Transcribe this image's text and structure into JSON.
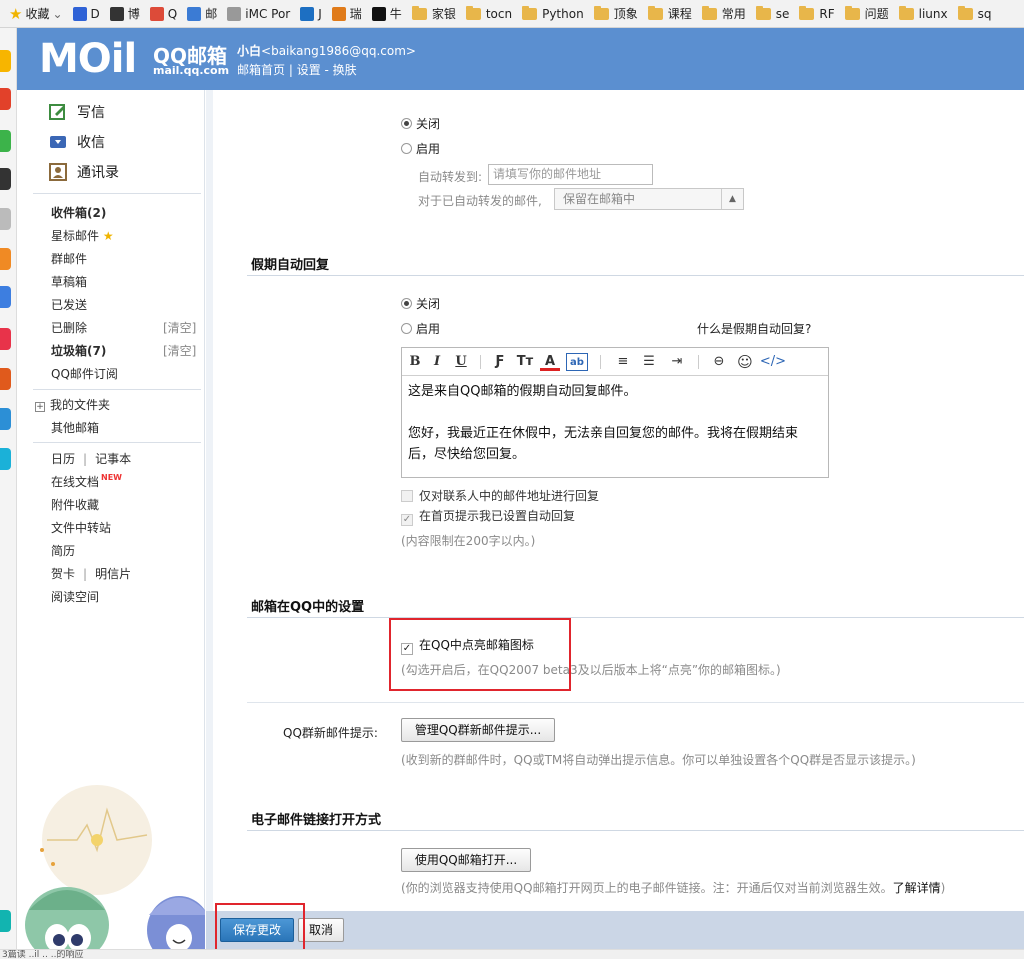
{
  "bookmarks": [
    {
      "label": "收藏",
      "icon": "star-icon",
      "color": "#f0b400",
      "chevron": true
    },
    {
      "label": "D",
      "icon": "paw-icon",
      "color": "#2f62d6"
    },
    {
      "label": "博",
      "icon": "weibo-icon",
      "color": "#333333"
    },
    {
      "label": "Q",
      "icon": "chrome-icon",
      "color": "#dd4b39"
    },
    {
      "label": "邮",
      "icon": "mail-icon",
      "color": "#3b7bd4"
    },
    {
      "label": "iMC Por",
      "icon": "page-icon",
      "color": "#999999"
    },
    {
      "label": "J",
      "icon": "code-icon",
      "color": "#1d6fc2"
    },
    {
      "label": "瑞",
      "icon": "home-icon",
      "color": "#e07b1a"
    },
    {
      "label": "牛",
      "icon": "cow-icon",
      "color": "#111111"
    },
    {
      "label": "家银",
      "icon": "folder-icon"
    },
    {
      "label": "tocn",
      "icon": "folder-icon"
    },
    {
      "label": "Python",
      "icon": "folder-icon"
    },
    {
      "label": "顶象",
      "icon": "folder-icon"
    },
    {
      "label": "课程",
      "icon": "folder-icon"
    },
    {
      "label": "常用",
      "icon": "folder-icon"
    },
    {
      "label": "se",
      "icon": "folder-icon"
    },
    {
      "label": "RF",
      "icon": "folder-icon"
    },
    {
      "label": "问题",
      "icon": "folder-icon"
    },
    {
      "label": "liunx",
      "icon": "folder-icon"
    },
    {
      "label": "sq",
      "icon": "folder-icon"
    }
  ],
  "header": {
    "logo_text": "MOil",
    "brand": "QQ邮箱",
    "url": "mail.qq.com",
    "user_name": "小白",
    "user_email": "<baikang1986@qq.com>",
    "link_home": "邮箱首页",
    "sep1": " | ",
    "link_settings": "设置",
    "sep2": " - ",
    "link_skin": "换肤"
  },
  "nav": {
    "compose": "写信",
    "inbox_top": "收信",
    "contacts": "通讯录",
    "inbox": "收件箱(2)",
    "starred": "星标邮件",
    "group": "群邮件",
    "drafts": "草稿箱",
    "sent": "已发送",
    "deleted": "已删除",
    "clear": "[清空]",
    "spam": "垃圾箱(7)",
    "subscribe": "QQ邮件订阅",
    "my_folders": "我的文件夹",
    "other_mail": "其他邮箱",
    "calendar": "日历",
    "notes": "记事本",
    "online_docs": "在线文档",
    "new_badge": "NEW",
    "attachments": "附件收藏",
    "file_transfer": "文件中转站",
    "resume": "简历",
    "greeting_card": "贺卡",
    "postcard": "明信片",
    "reading": "阅读空间",
    "divider": "|"
  },
  "forward": {
    "off_label": "关闭",
    "on_label": "启用",
    "selected": "off",
    "address_label": "自动转发到:",
    "address_placeholder": "请填写你的邮件地址",
    "after_label": "对于已自动转发的邮件,",
    "after_value": "保留在邮箱中"
  },
  "vacation": {
    "title": "假期自动回复",
    "off_label": "关闭",
    "on_label": "启用",
    "selected": "off",
    "help_link": "什么是假期自动回复?",
    "body_line1": "这是来自QQ邮箱的假期自动回复邮件。",
    "body_line2": "您好，我最近正在休假中，无法亲自回复您的邮件。我将在假期结束后，尽快给您回复。",
    "contacts_only": "仅对联系人中的邮件地址进行回复",
    "contacts_only_checked": false,
    "show_on_home": "在首页提示我已设置自动回复",
    "show_on_home_checked": true,
    "limit_hint": "(内容限制在200字以内。)"
  },
  "toolbar": {
    "bold": "B",
    "italic": "I",
    "underline": "U",
    "font": "Ƒ",
    "size": "Tт",
    "color": "A",
    "bg": "ab",
    "align": "≡",
    "list": "☰",
    "indent": "⇥",
    "link": "⊖",
    "emoji": "☺",
    "source": "</>"
  },
  "qq_settings": {
    "title": "邮箱在QQ中的设置",
    "light_icon_label": "在QQ中点亮邮箱图标",
    "light_icon_checked": true,
    "light_icon_hint": "(勾选开启后，在QQ2007 beta3及以后版本上将“点亮”你的邮箱图标。)",
    "group_label": "QQ群新邮件提示:",
    "group_button": "管理QQ群新邮件提示...",
    "group_hint": "(收到新的群邮件时，QQ或TM将自动弹出提示信息。你可以单独设置各个QQ群是否显示该提示。)"
  },
  "link_open": {
    "title": "电子邮件链接打开方式",
    "button": "使用QQ邮箱打开...",
    "hint": "(你的浏览器支持使用QQ邮箱打开网页上的电子邮件链接。注：开通后仅对当前浏览器生效。",
    "more": "了解详情",
    "hint_end": ")"
  },
  "footer": {
    "save": "保存更改",
    "cancel": "取消"
  },
  "status_bar": "3篇读  ..il  ..  ..的响应"
}
